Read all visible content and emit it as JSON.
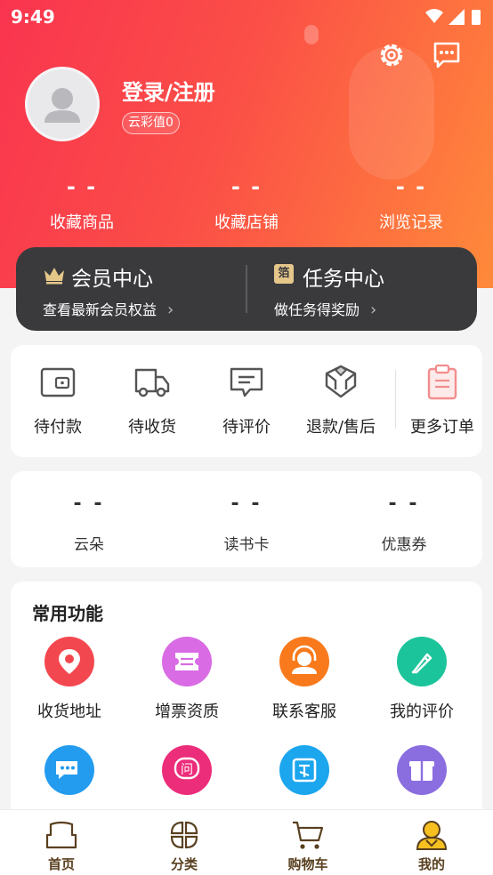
{
  "status_bar": {
    "time": "9:49"
  },
  "profile": {
    "login_label": "登录/注册",
    "score_label": "云彩值0"
  },
  "stats": [
    {
      "value": "- -",
      "label": "收藏商品"
    },
    {
      "value": "- -",
      "label": "收藏店铺"
    },
    {
      "value": "- -",
      "label": "浏览记录"
    }
  ],
  "member": {
    "title": "会员中心",
    "subtitle": "查看最新会员权益",
    "chevron": "›"
  },
  "task": {
    "title": "任务中心",
    "subtitle": "做任务得奖励",
    "chevron": "›",
    "badge_char": "箔"
  },
  "orders": [
    {
      "label": "待付款",
      "icon": "wallet-icon"
    },
    {
      "label": "待收货",
      "icon": "delivery-truck-icon"
    },
    {
      "label": "待评价",
      "icon": "comment-icon"
    },
    {
      "label": "退款/售后",
      "icon": "return-box-icon"
    },
    {
      "label": "更多订单",
      "icon": "clipboard-icon"
    }
  ],
  "assets": [
    {
      "value": "- -",
      "label": "云朵"
    },
    {
      "value": "- -",
      "label": "读书卡"
    },
    {
      "value": "- -",
      "label": "优惠券"
    }
  ],
  "functions": {
    "title": "常用功能",
    "items": [
      {
        "label": "收货地址",
        "icon": "location-pin-icon",
        "color": "#f3474f"
      },
      {
        "label": "增票资质",
        "icon": "ticket-icon",
        "color": "#d96be4"
      },
      {
        "label": "联系客服",
        "icon": "customer-service-icon",
        "color": "#f87a1c"
      },
      {
        "label": "我的评价",
        "icon": "edit-pencil-icon",
        "color": "#1cc49b"
      },
      {
        "label": "",
        "icon": "chat-bubbles-icon",
        "color": "#239cf0"
      },
      {
        "label": "",
        "icon": "question-icon",
        "color": "#ec2d7a"
      },
      {
        "label": "",
        "icon": "square-g-icon",
        "color": "#1ba6ee"
      },
      {
        "label": "",
        "icon": "gift-icon",
        "color": "#8a6ee0"
      }
    ]
  },
  "tabbar": [
    {
      "label": "首页",
      "icon": "home-icon"
    },
    {
      "label": "分类",
      "icon": "category-icon"
    },
    {
      "label": "购物车",
      "icon": "cart-icon"
    },
    {
      "label": "我的",
      "icon": "profile-icon",
      "active": true
    }
  ]
}
